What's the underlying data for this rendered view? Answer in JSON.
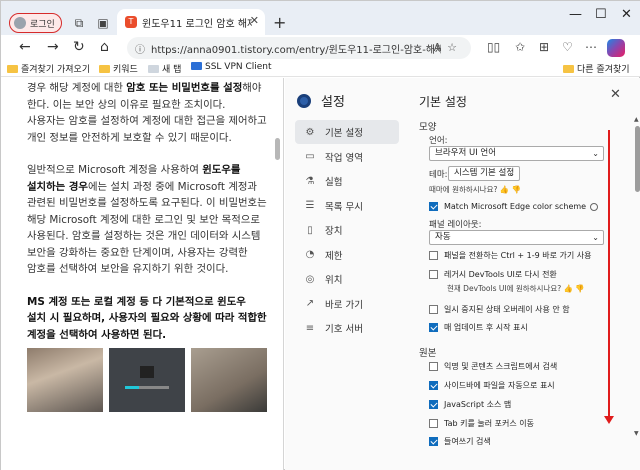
{
  "browser": {
    "profile_label": "로그인",
    "tab_title": "윈도우11 로그인 암호 해제 - 비밀",
    "tab_favicon": "T",
    "url": "https://anna0901.tistory.com/entry/윈도우11-로그인-암호-해제-비밀번호-없이-...",
    "bookmarks": {
      "import": "즐겨찾기 가져오기",
      "keyword": "키워드",
      "new_tab": "새 탭",
      "vpn": "SSL VPN Client",
      "other": "다른 즐겨찾기"
    }
  },
  "article": {
    "p1_a": "경우 해당 계정에 대한 ",
    "p1_b": "암호 또는 비밀번호를 설정",
    "p1_c": "해야 한다. 이는 보안 상의 이유로 필요한 조치이다. 사용자는 암호를 설정하여 계정에 대한 접근을 제어하고 개인 정보를 안전하게 보호할 수 있기 때문이다.",
    "p2_a": "일반적으로 Microsoft 계정을 사용하여 ",
    "p2_b": "윈도우를 설치하는 경우",
    "p2_c": "에는 설치 과정 중에 Microsoft 계정과 관련된 비밀번호를 설정하도록 요구된다. 이 비밀번호는 해당 Microsoft 계정에 대한 로그인 및 보안 목적으로 사용된다. 암호를 설정하는 것은 개인 데이터와 시스템 보안을 강화하는 중요한 단계이며, 사용자는 강력한 암호를 선택하여 보안을 유지하기 위한 것이다.",
    "p3": "MS 계정 또는 로컬 계정 등 다 기본적으로 윈도우 설치 시 필요하며, 사용자의 필요와 상황에 따라 적합한 계정을 선택하여 사용하면 된다."
  },
  "settings": {
    "title": "설정",
    "page_heading": "기본 설정",
    "nav": [
      {
        "label": "기본 설정",
        "icon": "gear"
      },
      {
        "label": "작업 영역",
        "icon": "workspace"
      },
      {
        "label": "실험",
        "icon": "flask"
      },
      {
        "label": "목록 무시",
        "icon": "ignore-list"
      },
      {
        "label": "장치",
        "icon": "device"
      },
      {
        "label": "제한",
        "icon": "throttle"
      },
      {
        "label": "위치",
        "icon": "location"
      },
      {
        "label": "바로 가기",
        "icon": "shortcut"
      },
      {
        "label": "기호 서버",
        "icon": "symbol-server"
      }
    ],
    "appearance": {
      "section": "모양",
      "language_label": "언어:",
      "language_value": "브라우저 UI 언어",
      "theme_label": "테마:",
      "theme_value": "시스템 기본 설정",
      "helpful": "때마에 원하하시나요?",
      "match_edge": "Match Microsoft Edge color scheme",
      "panel_layout_label": "패널 레이아웃:",
      "panel_layout_value": "자동",
      "ctrl_shortcut": "패널을 전환하는 Ctrl + 1-9 바로 가기 사용",
      "load_devtools": "레거시 DevTools UI로 다시 전환",
      "devtools_helpful": "현재 DevTools UI에 원하하시나요?",
      "pause_overlay": "일시 중지된 상태 오버레이 사용 안 함",
      "show_whats_new": "매 업데이트 후 시작 표시"
    },
    "sources": {
      "section": "원본",
      "search_anon": "익명 및 콘텐츠 스크립트에서 검색",
      "reveal_sidebar": "사이드바에 파일을 자동으로 표시",
      "js_sourcemaps": "JavaScript 소스 맵",
      "tab_focus": "Tab 키를 눌러 포커스 이동",
      "code_folding": "들여쓰기 검색"
    },
    "checks": {
      "match_edge": true,
      "ctrl_shortcut": false,
      "load_devtools": false,
      "pause_overlay": false,
      "show_whats_new": true,
      "search_anon": false,
      "reveal_sidebar": true,
      "js_sourcemaps": true,
      "tab_focus": false,
      "code_folding": true
    }
  }
}
